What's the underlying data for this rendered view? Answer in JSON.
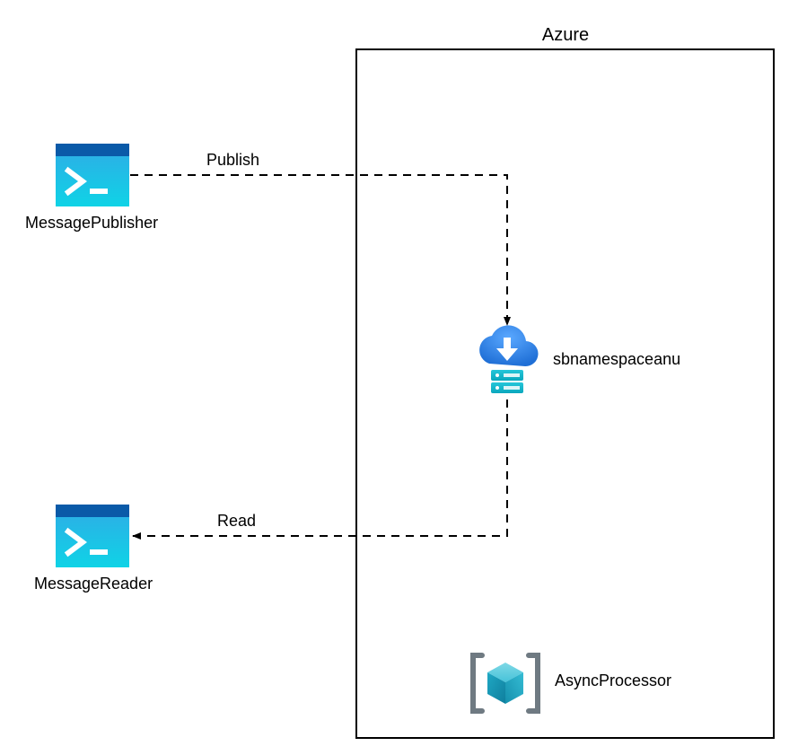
{
  "diagram": {
    "container": {
      "title": "Azure"
    },
    "nodes": {
      "publisher": {
        "label": "MessagePublisher",
        "icon": "terminal-icon"
      },
      "reader": {
        "label": "MessageReader",
        "icon": "terminal-icon"
      },
      "servicebus": {
        "label": "sbnamespaceanu",
        "icon": "cloud-service-bus-icon"
      },
      "resourcegroup": {
        "label": "AsyncProcessor",
        "icon": "resource-group-icon"
      }
    },
    "edges": {
      "publish": {
        "label": "Publish",
        "from": "publisher",
        "to": "servicebus"
      },
      "read": {
        "label": "Read",
        "from": "servicebus",
        "to": "reader"
      }
    }
  }
}
